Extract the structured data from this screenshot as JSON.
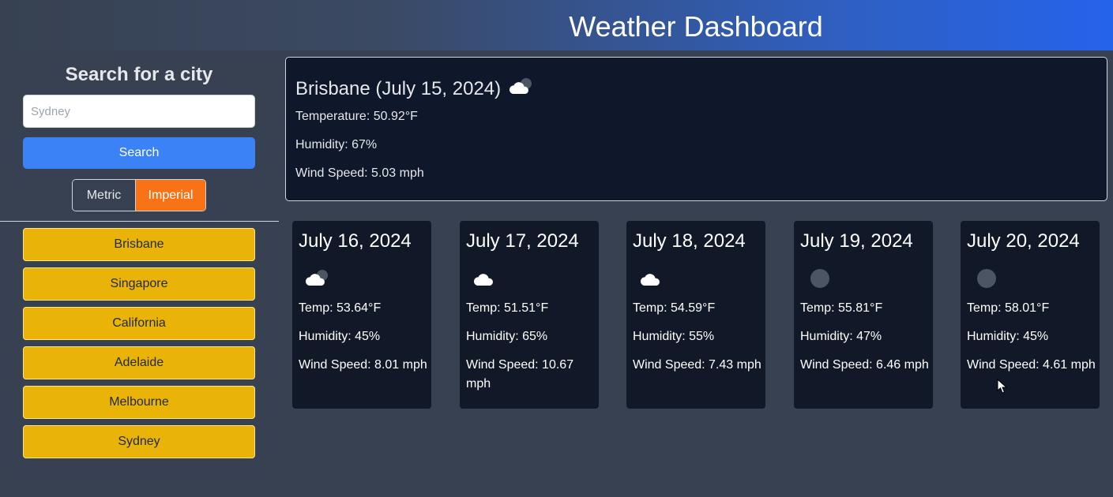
{
  "header": {
    "title": "Weather Dashboard"
  },
  "search": {
    "title": "Search for a city",
    "placeholder": "Sydney",
    "button_label": "Search"
  },
  "units": {
    "metric_label": "Metric",
    "imperial_label": "Imperial",
    "selected": "Imperial"
  },
  "history": [
    {
      "label": "Brisbane"
    },
    {
      "label": "Singapore"
    },
    {
      "label": "California"
    },
    {
      "label": "Adelaide"
    },
    {
      "label": "Melbourne"
    },
    {
      "label": "Sydney"
    }
  ],
  "current": {
    "title": "Brisbane (July 15, 2024)",
    "icon": "cloud-night-icon",
    "temperature": "Temperature: 50.92°F",
    "humidity": "Humidity: 67%",
    "wind": "Wind Speed: 5.03 mph"
  },
  "forecast": [
    {
      "date": "July 16, 2024",
      "icon": "cloud-night-icon",
      "temp": "Temp: 53.64°F",
      "humidity": "Humidity: 45%",
      "wind": "Wind Speed: 8.01 mph"
    },
    {
      "date": "July 17, 2024",
      "icon": "cloud-icon",
      "temp": "Temp: 51.51°F",
      "humidity": "Humidity: 65%",
      "wind": "Wind Speed: 10.67 mph"
    },
    {
      "date": "July 18, 2024",
      "icon": "cloud-icon",
      "temp": "Temp: 54.59°F",
      "humidity": "Humidity: 55%",
      "wind": "Wind Speed: 7.43 mph"
    },
    {
      "date": "July 19, 2024",
      "icon": "moon-icon",
      "temp": "Temp: 55.81°F",
      "humidity": "Humidity: 47%",
      "wind": "Wind Speed: 6.46 mph"
    },
    {
      "date": "July 20, 2024",
      "icon": "moon-icon",
      "temp": "Temp: 58.01°F",
      "humidity": "Humidity: 45%",
      "wind": "Wind Speed: 4.61 mph"
    }
  ],
  "colors": {
    "accent_blue": "#3b82f6",
    "imperial_active": "#f97316",
    "history_button": "#eab308",
    "card_background": "#0f172a"
  }
}
